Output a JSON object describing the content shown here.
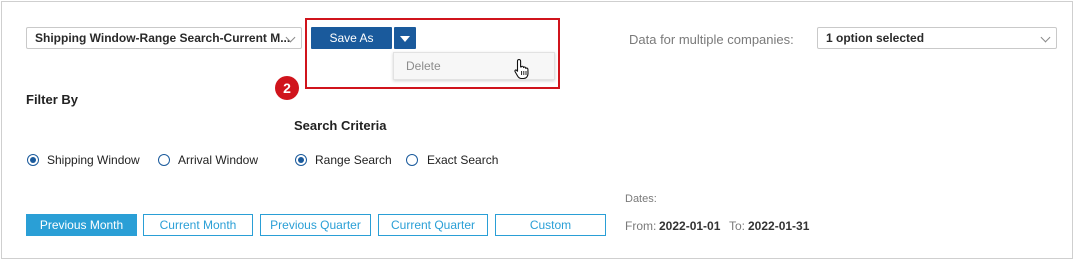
{
  "saved_search": {
    "value": "Shipping Window-Range Search-Current M..."
  },
  "save_as": {
    "label": "Save As"
  },
  "dropdown": {
    "delete_label": "Delete"
  },
  "annotation": {
    "step": "2"
  },
  "companies": {
    "label": "Data for multiple companies:",
    "value": "1 option selected"
  },
  "filter": {
    "heading": "Filter By",
    "options": [
      "Shipping Window",
      "Arrival Window"
    ],
    "selected": "Shipping Window"
  },
  "criteria": {
    "heading": "Search Criteria",
    "options": [
      "Range Search",
      "Exact Search"
    ],
    "selected": "Range Search"
  },
  "periods": {
    "buttons": [
      "Previous Month",
      "Current Month",
      "Previous Quarter",
      "Current Quarter",
      "Custom"
    ],
    "active": "Previous Month"
  },
  "dates": {
    "label": "Dates:",
    "from_label": "From:",
    "from_value": "2022-01-01",
    "to_label": "To:",
    "to_value": "2022-01-31"
  },
  "colors": {
    "primary": "#1a5a9c",
    "accent": "#2a9fd6",
    "annotation_red": "#d0141c"
  },
  "icons": [
    "chevron-down-icon",
    "caret-down-icon",
    "pointer-hand-icon"
  ]
}
